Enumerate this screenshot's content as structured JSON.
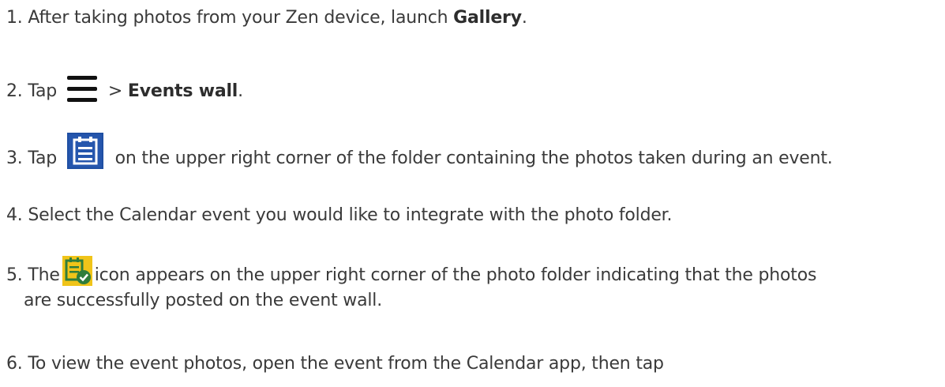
{
  "steps": [
    {
      "number": "1.",
      "text_before": "After taking photos from your Zen device, launch ",
      "bold": "Gallery",
      "text_after": "."
    },
    {
      "number": "2.",
      "text_before": "Tap",
      "separator": "> ",
      "bold": "Events wall",
      "text_after": "."
    },
    {
      "number": "3.",
      "text_before": "Tap",
      "text_after": "on the upper right corner of the folder containing the photos taken during an event."
    },
    {
      "number": "4.",
      "text": "Select the Calendar event you would like to integrate with the photo folder."
    },
    {
      "number": "5.",
      "text_before": "The",
      "text_after": "icon appears on the upper right corner of the photo folder indicating that the photos",
      "continuation": "are successfully posted on the event wall."
    },
    {
      "number": "6.",
      "text": "To view the event photos, open the event from the Calendar app, then tap"
    }
  ],
  "icons": {
    "menu": "hamburger-menu-icon",
    "calendar": "calendar-event-icon",
    "posted": "event-posted-icon"
  },
  "colors": {
    "text": "#3a3a3a",
    "calendar_icon_bg": "#1f4fa3",
    "posted_icon_bg": "#f0c419",
    "posted_check": "#2f7d3b"
  }
}
